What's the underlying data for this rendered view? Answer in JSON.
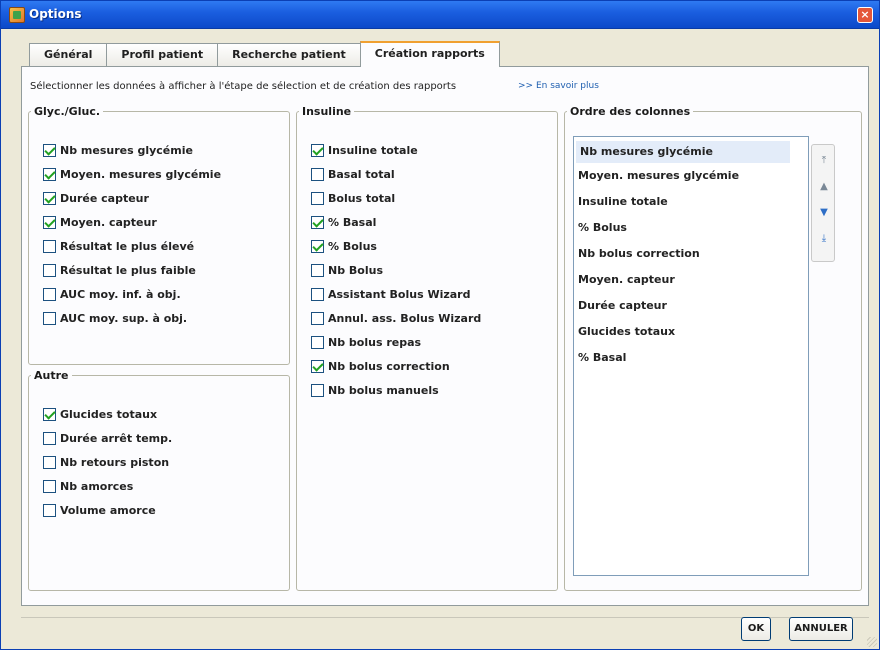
{
  "window": {
    "title": "Options",
    "close_glyph": "×",
    "icon": "app-options-icon"
  },
  "tabs": [
    {
      "label": "Général",
      "active": false
    },
    {
      "label": "Profil patient",
      "active": false
    },
    {
      "label": "Recherche patient",
      "active": false
    },
    {
      "label": "Création rapports",
      "active": true
    }
  ],
  "panel": {
    "intro": "Sélectionner les données à afficher à l'étape de sélection et de création des rapports",
    "learn_more": ">> En savoir plus"
  },
  "glyc": {
    "legend": "Glyc./Gluc.",
    "items": [
      {
        "label": "Nb mesures glycémie",
        "checked": true
      },
      {
        "label": "Moyen. mesures glycémie",
        "checked": true
      },
      {
        "label": "Durée capteur",
        "checked": true
      },
      {
        "label": "Moyen. capteur",
        "checked": true
      },
      {
        "label": "Résultat le plus élevé",
        "checked": false
      },
      {
        "label": "Résultat le plus faible",
        "checked": false
      },
      {
        "label": "AUC moy. inf. à obj.",
        "checked": false
      },
      {
        "label": "AUC moy. sup. à obj.",
        "checked": false
      }
    ]
  },
  "autre": {
    "legend": "Autre",
    "items": [
      {
        "label": "Glucides totaux",
        "checked": true
      },
      {
        "label": "Durée arrêt temp.",
        "checked": false
      },
      {
        "label": "Nb retours piston",
        "checked": false
      },
      {
        "label": "Nb amorces",
        "checked": false
      },
      {
        "label": "Volume amorce",
        "checked": false
      }
    ]
  },
  "insuline": {
    "legend": "Insuline",
    "items": [
      {
        "label": "Insuline totale",
        "checked": true
      },
      {
        "label": "Basal total",
        "checked": false
      },
      {
        "label": "Bolus total",
        "checked": false
      },
      {
        "label": "% Basal",
        "checked": true
      },
      {
        "label": "% Bolus",
        "checked": true
      },
      {
        "label": "Nb Bolus",
        "checked": false
      },
      {
        "label": "Assistant Bolus Wizard",
        "checked": false
      },
      {
        "label": "Annul. ass. Bolus Wizard",
        "checked": false
      },
      {
        "label": "Nb bolus repas",
        "checked": false
      },
      {
        "label": "Nb bolus correction",
        "checked": true
      },
      {
        "label": "Nb bolus manuels",
        "checked": false
      }
    ]
  },
  "ordre": {
    "legend": "Ordre des colonnes",
    "items": [
      "Nb mesures glycémie",
      "Moyen. mesures glycémie",
      "Insuline totale",
      "% Bolus",
      "Nb bolus correction",
      "Moyen. capteur",
      "Durée capteur",
      "Glucides totaux",
      "% Basal"
    ],
    "selected_index": 0,
    "controls": [
      {
        "name": "move-top-icon",
        "glyph": "⤒",
        "enabled": false
      },
      {
        "name": "move-up-icon",
        "glyph": "▲",
        "enabled": false
      },
      {
        "name": "move-down-icon",
        "glyph": "▼",
        "enabled": true
      },
      {
        "name": "move-bottom-icon",
        "glyph": "⤓",
        "enabled": true
      }
    ]
  },
  "buttons": {
    "ok": "OK",
    "cancel": "ANNULER"
  }
}
